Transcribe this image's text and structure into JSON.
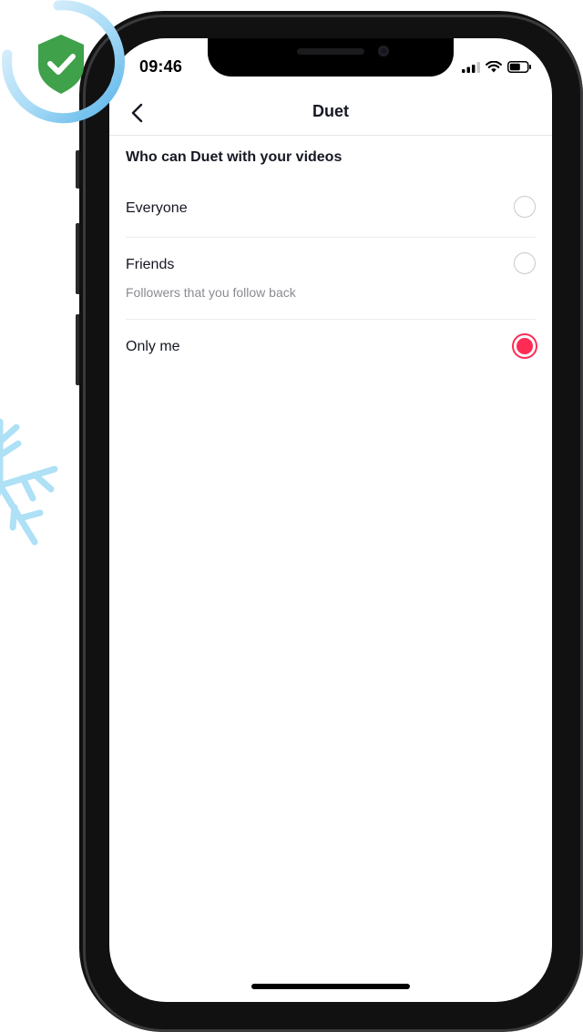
{
  "status_bar": {
    "time": "09:46"
  },
  "nav": {
    "title": "Duet",
    "back_icon": "chevron-left-icon"
  },
  "section": {
    "heading": "Who can Duet with your videos"
  },
  "options": [
    {
      "label": "Everyone",
      "sublabel": "",
      "selected": false
    },
    {
      "label": "Friends",
      "sublabel": "Followers that you follow back",
      "selected": false
    },
    {
      "label": "Only me",
      "sublabel": "",
      "selected": true
    }
  ],
  "colors": {
    "accent": "#fe2c55",
    "shield": "#3fa14a",
    "ring": "#8ccbf0",
    "snowflake": "#aee0f6"
  },
  "icons": {
    "badge": "shield-check-icon",
    "decoration": "snowflake-icon",
    "signal": "signal-icon",
    "wifi": "wifi-icon",
    "battery": "battery-icon"
  }
}
